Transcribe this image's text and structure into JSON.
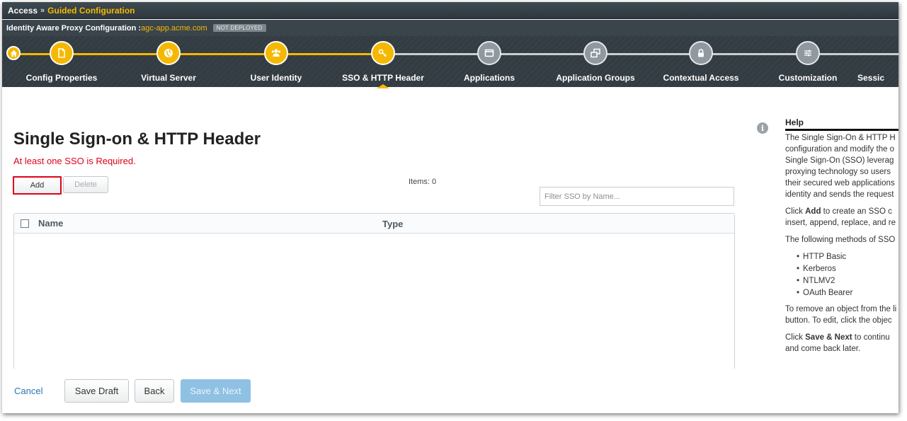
{
  "breadcrumb": {
    "root": "Access",
    "separator": "»",
    "current": "Guided Configuration"
  },
  "config_header": {
    "label": "Identity Aware Proxy Configuration :",
    "app_name": "agc-app.acme.com",
    "status_badge": "NOT DEPLOYED"
  },
  "wizard": {
    "home_icon": "home-icon",
    "steps": [
      {
        "label": "Config Properties",
        "icon": "document-icon",
        "state": "done"
      },
      {
        "label": "Virtual Server",
        "icon": "globe-icon",
        "state": "done"
      },
      {
        "label": "User Identity",
        "icon": "users-icon",
        "state": "done"
      },
      {
        "label": "SSO & HTTP Header",
        "icon": "key-icon",
        "state": "current"
      },
      {
        "label": "Applications",
        "icon": "window-icon",
        "state": "todo"
      },
      {
        "label": "Application Groups",
        "icon": "windows-group-icon",
        "state": "todo"
      },
      {
        "label": "Contextual Access",
        "icon": "lock-icon",
        "state": "todo"
      },
      {
        "label": "Customization",
        "icon": "sliders-icon",
        "state": "todo"
      },
      {
        "label": "Sessic",
        "icon": "",
        "state": "todo"
      }
    ]
  },
  "main": {
    "title": "Single Sign-on & HTTP Header",
    "error_message": "At least one SSO is Required.",
    "add_label": "Add",
    "delete_label": "Delete",
    "items_count": "Items: 0",
    "filter_placeholder": "Filter SSO by Name...",
    "table": {
      "columns": [
        "Name",
        "Type"
      ],
      "rows": []
    }
  },
  "footer": {
    "cancel_label": "Cancel",
    "save_draft_label": "Save Draft",
    "back_label": "Back",
    "save_next_label": "Save & Next"
  },
  "help": {
    "title": "Help",
    "p1": [
      "The Single Sign-On & HTTP H",
      "configuration and modify the o",
      "Single Sign-On (SSO) leverag",
      "proxying technology so users",
      "their secured web applications",
      "identity and sends the request"
    ],
    "p2_bold": "Add",
    "p2_pre": "Click ",
    "p2_lines": [
      " to create an SSO c",
      "insert, append, replace, and re"
    ],
    "p3": "The following methods of SSO",
    "methods": [
      "HTTP Basic",
      "Kerberos",
      "NTLMV2",
      "OAuth Bearer"
    ],
    "p4": [
      "To remove an object from the li",
      "button. To edit, click the objec"
    ],
    "p5_pre": "Click ",
    "p5_bold": "Save & Next",
    "p5_lines": [
      " to continu",
      "and come back later."
    ]
  },
  "colors": {
    "accent": "#f5b800",
    "error": "#e0001a",
    "link": "#2e75b6",
    "primary_disabled": "#8fc1e3"
  }
}
